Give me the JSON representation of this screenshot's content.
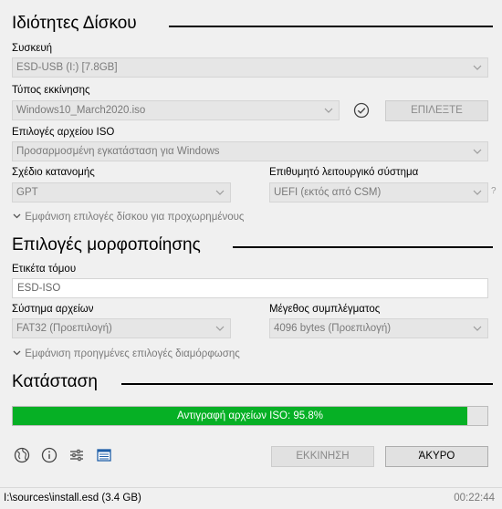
{
  "drive_properties": {
    "title": "Ιδιότητες Δίσκου",
    "device_label": "Συσκευή",
    "device_value": "ESD-USB (I:) [7.8GB]",
    "boot_label": "Τύπος εκκίνησης",
    "boot_value": "Windows10_March2020.iso",
    "select_button": "ΕΠΙΛΕΞΤΕ",
    "iso_label": "Επιλογές αρχείου ISO",
    "iso_value": "Προσαρμοσμένη εγκατάσταση για Windows",
    "partition_label": "Σχέδιο κατανομής",
    "partition_value": "GPT",
    "target_label": "Επιθυμητό λειτουργικό σύστημα",
    "target_value": "UEFI (εκτός από CSM)",
    "help_mark": "?",
    "advanced_toggle": "Εμφάνιση επιλογές δίσκου για προχωρημένους"
  },
  "format_options": {
    "title": "Επιλογές μορφοποίησης",
    "volume_label": "Ετικέτα τόμου",
    "volume_value": "ESD-ISO",
    "fs_label": "Σύστημα αρχείων",
    "fs_value": "FAT32 (Προεπιλογή)",
    "cluster_label": "Μέγεθος συμπλέγματος",
    "cluster_value": "4096 bytes (Προεπιλογή)",
    "advanced_toggle": "Εμφάνιση προηγμένες επιλογές διαμόρφωσης"
  },
  "status": {
    "title": "Κατάσταση",
    "progress_text": "Αντιγραφή αρχείων ISO: 95.8%",
    "progress_fraction": 0.958,
    "progress_color": "#06b025"
  },
  "actions": {
    "start_button": "ΕΚΚΙΝΗΣΗ",
    "cancel_button": "ΆΚΥΡΟ",
    "icons": [
      "globe-icon",
      "info-icon",
      "settings-sliders-icon",
      "log-icon"
    ]
  },
  "statusbar": {
    "file": "I:\\sources\\install.esd (3.4 GB)",
    "elapsed": "00:22:44"
  }
}
